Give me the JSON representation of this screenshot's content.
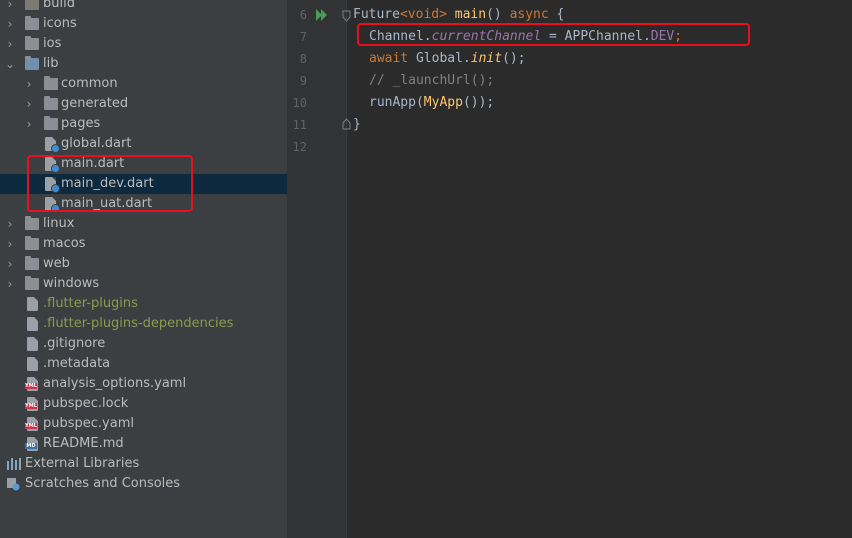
{
  "tree": {
    "build": "build",
    "icons": "icons",
    "ios": "ios",
    "lib": "lib",
    "common": "common",
    "generated": "generated",
    "pages": "pages",
    "global": "global.dart",
    "main": "main.dart",
    "main_dev": "main_dev.dart",
    "main_uat": "main_uat.dart",
    "linux": "linux",
    "macos": "macos",
    "web": "web",
    "windows": "windows",
    "flutter_plugins": ".flutter-plugins",
    "flutter_plugins_deps": ".flutter-plugins-dependencies",
    "gitignore": ".gitignore",
    "metadata": ".metadata",
    "analysis": "analysis_options.yaml",
    "pubspec_lock": "pubspec.lock",
    "pubspec_yaml": "pubspec.yaml",
    "readme": "README.md",
    "external": "External Libraries",
    "scratches": "Scratches and Consoles"
  },
  "badges": {
    "yml": "YML",
    "md": "MD"
  },
  "line_numbers": [
    "6",
    "7",
    "8",
    "9",
    "10",
    "11",
    "12"
  ],
  "code": {
    "l6_type": "Future",
    "l6_lt": "<",
    "l6_void": "void",
    "l6_gt": "> ",
    "l6_main": "main",
    "l6_paren": "() ",
    "l6_async": "async",
    "l6_brace": " {",
    "l7_channel": "Channel.",
    "l7_current": "currentChannel",
    "l7_eq": " = APPChannel.",
    "l7_dev": "DEV",
    "l7_semi": ";",
    "l8_await": "await ",
    "l8_global": "Global.",
    "l8_init": "init",
    "l8_end": "();",
    "l9_comment": "// _launchUrl();",
    "l10_run": "runApp(",
    "l10_myapp": "MyApp",
    "l10_end": "());",
    "l11_brace": "}"
  },
  "colors": {
    "highlight": "#e8101d",
    "selection": "#0d293e"
  }
}
